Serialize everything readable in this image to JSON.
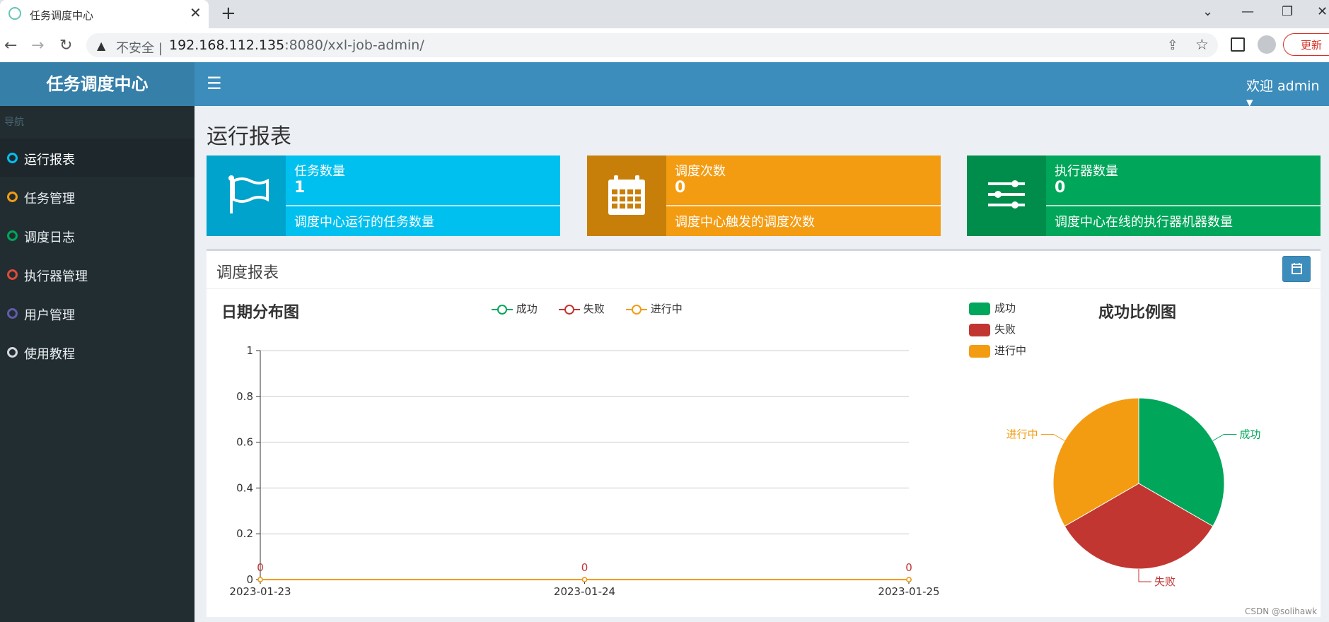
{
  "browser": {
    "tab_title": "任务调度中心",
    "tab_close": "✕",
    "new_tab": "+",
    "insecure_label": "不安全 |",
    "url_host": "192.168.112.135",
    "url_rest": ":8080/xxl-job-admin/",
    "update_label": "更新"
  },
  "header": {
    "logo": "任务调度中心",
    "welcome": "欢迎 admin ▾"
  },
  "sidebar": {
    "nav_header": "导航",
    "items": [
      {
        "label": "运行报表",
        "color": "#00c0ef",
        "active": true
      },
      {
        "label": "任务管理",
        "color": "#f39c12",
        "active": false
      },
      {
        "label": "调度日志",
        "color": "#00a65a",
        "active": false
      },
      {
        "label": "执行器管理",
        "color": "#dd4b39",
        "active": false
      },
      {
        "label": "用户管理",
        "color": "#605ca8",
        "active": false
      },
      {
        "label": "使用教程",
        "color": "#d2d6de",
        "active": false
      }
    ]
  },
  "page_title": "运行报表",
  "infoboxes": [
    {
      "title": "任务数量",
      "value": "1",
      "desc": "调度中心运行的任务数量",
      "bg": "#00c0ef",
      "icon_bg": "#00a3cb",
      "icon": "flag-icon"
    },
    {
      "title": "调度次数",
      "value": "0",
      "desc": "调度中心触发的调度次数",
      "bg": "#f39c12",
      "icon_bg": "#c87f0a",
      "icon": "calendar-icon"
    },
    {
      "title": "执行器数量",
      "value": "0",
      "desc": "调度中心在线的执行器机器数量",
      "bg": "#00a65a",
      "icon_bg": "#008d4c",
      "icon": "sliders-icon"
    }
  ],
  "panel": {
    "title": "调度报表"
  },
  "watermark": "CSDN @solihawk",
  "chart_data": [
    {
      "type": "line",
      "title": "日期分布图",
      "categories": [
        "2023-01-23",
        "2023-01-24",
        "2023-01-25"
      ],
      "series": [
        {
          "name": "成功",
          "values": [
            0,
            0,
            0
          ],
          "color": "#00a65a"
        },
        {
          "name": "失败",
          "values": [
            0,
            0,
            0
          ],
          "color": "#c23632"
        },
        {
          "name": "进行中",
          "values": [
            0,
            0,
            0
          ],
          "color": "#f39c12"
        }
      ],
      "data_labels": [
        "0",
        "0",
        "0"
      ],
      "ylim": [
        0,
        1
      ],
      "yticks": [
        "0",
        "0.2",
        "0.4",
        "0.6",
        "0.8",
        "1"
      ],
      "grid": true,
      "legend": "top-center"
    },
    {
      "type": "pie",
      "title": "成功比例图",
      "slices": [
        {
          "label": "成功",
          "value": 1,
          "color": "#00a65a"
        },
        {
          "label": "失败",
          "value": 1,
          "color": "#c23632"
        },
        {
          "label": "进行中",
          "value": 1,
          "color": "#f39c12"
        }
      ],
      "legend": "top-left"
    }
  ]
}
